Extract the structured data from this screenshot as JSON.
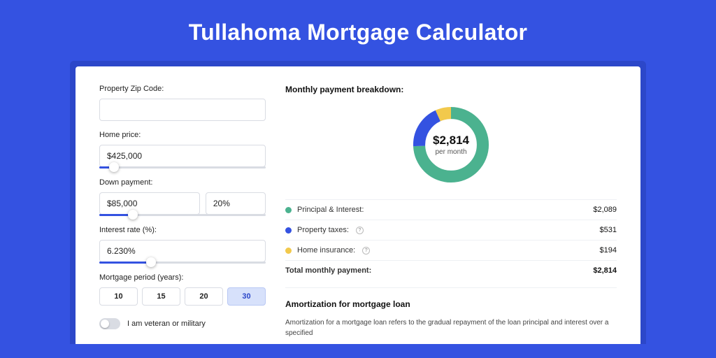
{
  "title": "Tullahoma Mortgage Calculator",
  "form": {
    "zip_label": "Property Zip Code:",
    "zip_value": "",
    "home_price_label": "Home price:",
    "home_price_value": "$425,000",
    "home_price_slider_pct": 9,
    "down_label": "Down payment:",
    "down_value": "$85,000",
    "down_pct_value": "20%",
    "down_slider_pct": 20,
    "rate_label": "Interest rate (%):",
    "rate_value": "6.230%",
    "rate_slider_pct": 31,
    "period_label": "Mortgage period (years):",
    "periods": [
      "10",
      "15",
      "20",
      "30"
    ],
    "period_active_index": 3,
    "veteran_label": "I am veteran or military"
  },
  "breakdown": {
    "title": "Monthly payment breakdown:",
    "center_amount": "$2,814",
    "center_sub": "per month",
    "rows": [
      {
        "color": "#4bb28f",
        "label": "Principal & Interest:",
        "value": "$2,089",
        "info": false
      },
      {
        "color": "#3452e1",
        "label": "Property taxes:",
        "value": "$531",
        "info": true
      },
      {
        "color": "#f2c94c",
        "label": "Home insurance:",
        "value": "$194",
        "info": true
      }
    ],
    "total_label": "Total monthly payment:",
    "total_value": "$2,814"
  },
  "amortization": {
    "title": "Amortization for mortgage loan",
    "text": "Amortization for a mortgage loan refers to the gradual repayment of the loan principal and interest over a specified"
  },
  "chart_data": {
    "type": "pie",
    "title": "Monthly payment breakdown",
    "series": [
      {
        "name": "Principal & Interest",
        "value": 2089,
        "color": "#4bb28f"
      },
      {
        "name": "Property taxes",
        "value": 531,
        "color": "#3452e1"
      },
      {
        "name": "Home insurance",
        "value": 194,
        "color": "#f2c94c"
      }
    ],
    "total": 2814,
    "center_label": "$2,814 per month"
  }
}
